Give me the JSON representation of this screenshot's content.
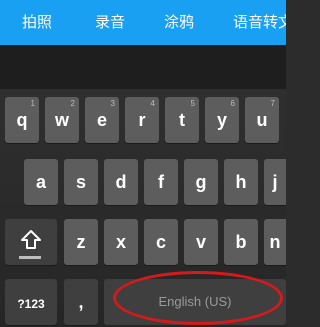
{
  "toolbar": {
    "items": [
      {
        "label": "拍照"
      },
      {
        "label": "录音"
      },
      {
        "label": "涂鸦"
      },
      {
        "label": "语音转文"
      }
    ]
  },
  "keyboard": {
    "row1": [
      {
        "label": "q",
        "hint": "1"
      },
      {
        "label": "w",
        "hint": "2"
      },
      {
        "label": "e",
        "hint": "3"
      },
      {
        "label": "r",
        "hint": "4"
      },
      {
        "label": "t",
        "hint": "5"
      },
      {
        "label": "y",
        "hint": "6"
      },
      {
        "label": "u",
        "hint": "7"
      }
    ],
    "row2": [
      {
        "label": "a"
      },
      {
        "label": "s"
      },
      {
        "label": "d"
      },
      {
        "label": "f"
      },
      {
        "label": "g"
      },
      {
        "label": "h"
      },
      {
        "label": "j"
      }
    ],
    "row3": [
      {
        "label": "z"
      },
      {
        "label": "x"
      },
      {
        "label": "c"
      },
      {
        "label": "v"
      },
      {
        "label": "b"
      },
      {
        "label": "n"
      }
    ],
    "symbols_label": "?123",
    "comma_label": ",",
    "space_label": "English (US)",
    "shift_icon": "shift-arrow-icon"
  },
  "colors": {
    "toolbar_bg": "#1aa0f2",
    "key_bg": "#5d5d5d",
    "highlight_circle": "#d41a1a"
  }
}
